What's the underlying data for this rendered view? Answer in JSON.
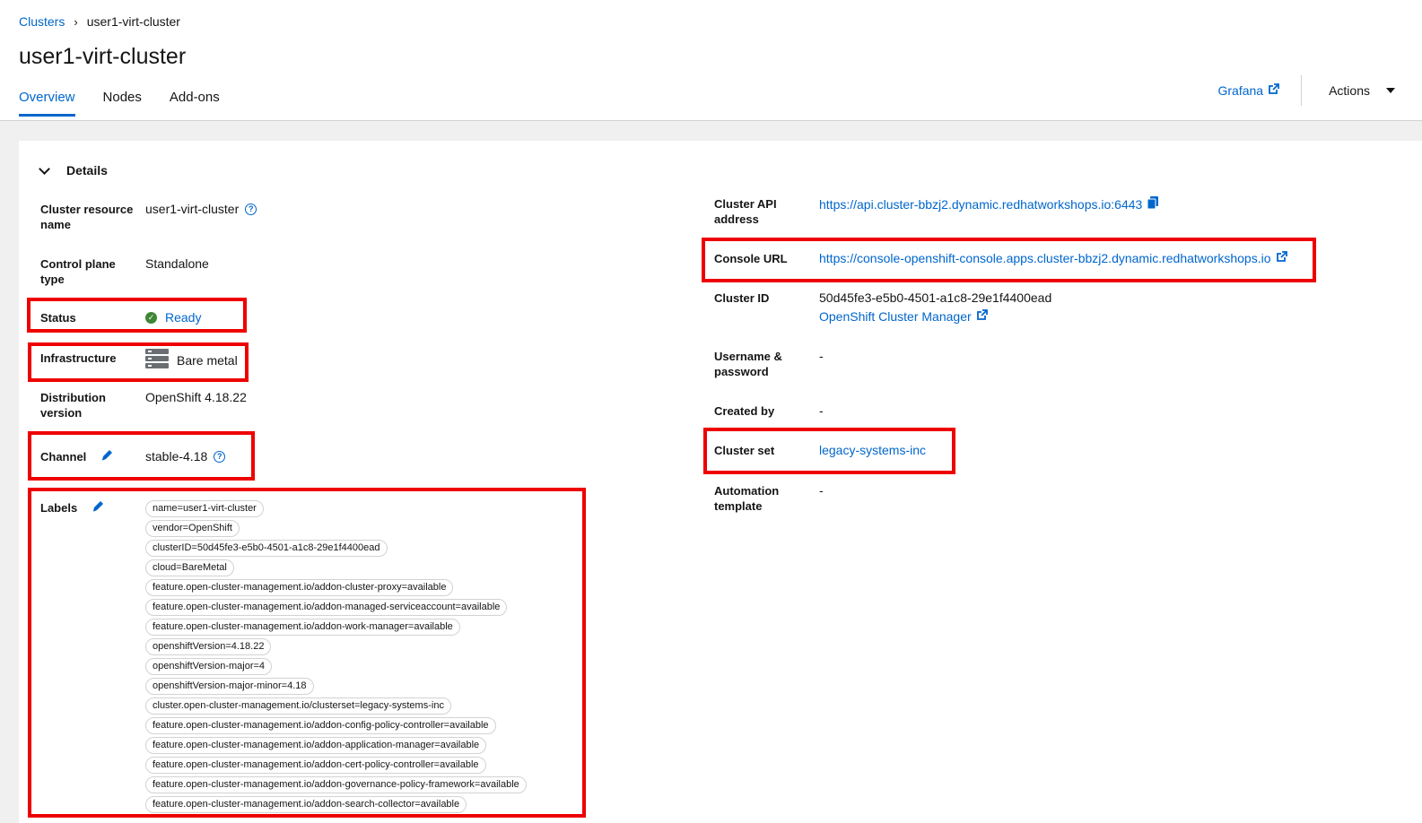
{
  "breadcrumb": {
    "root": "Clusters",
    "current": "user1-virt-cluster"
  },
  "page_title": "user1-virt-cluster",
  "tabs": [
    {
      "label": "Overview",
      "active": true
    },
    {
      "label": "Nodes",
      "active": false
    },
    {
      "label": "Add-ons",
      "active": false
    }
  ],
  "header_actions": {
    "grafana": "Grafana",
    "actions": "Actions"
  },
  "details": {
    "section_title": "Details",
    "left": {
      "resource_name_label": "Cluster resource name",
      "resource_name_value": "user1-virt-cluster",
      "control_plane_label": "Control plane type",
      "control_plane_value": "Standalone",
      "status_label": "Status",
      "status_value": "Ready",
      "infrastructure_label": "Infrastructure",
      "infrastructure_value": "Bare metal",
      "distribution_label": "Distribution version",
      "distribution_value": "OpenShift 4.18.22",
      "channel_label": "Channel",
      "channel_value": "stable-4.18",
      "labels_label": "Labels"
    },
    "labels": [
      "name=user1-virt-cluster",
      "vendor=OpenShift",
      "clusterID=50d45fe3-e5b0-4501-a1c8-29e1f4400ead",
      "cloud=BareMetal",
      "feature.open-cluster-management.io/addon-cluster-proxy=available",
      "feature.open-cluster-management.io/addon-managed-serviceaccount=available",
      "feature.open-cluster-management.io/addon-work-manager=available",
      "openshiftVersion=4.18.22",
      "openshiftVersion-major=4",
      "openshiftVersion-major-minor=4.18",
      "cluster.open-cluster-management.io/clusterset=legacy-systems-inc",
      "feature.open-cluster-management.io/addon-config-policy-controller=available",
      "feature.open-cluster-management.io/addon-application-manager=available",
      "feature.open-cluster-management.io/addon-cert-policy-controller=available",
      "feature.open-cluster-management.io/addon-governance-policy-framework=available",
      "feature.open-cluster-management.io/addon-search-collector=available"
    ],
    "right": {
      "api_label": "Cluster API address",
      "api_value": "https://api.cluster-bbzj2.dynamic.redhatworkshops.io:6443",
      "console_label": "Console URL",
      "console_value": "https://console-openshift-console.apps.cluster-bbzj2.dynamic.redhatworkshops.io",
      "cluster_id_label": "Cluster ID",
      "cluster_id_value": "50d45fe3-e5b0-4501-a1c8-29e1f4400ead",
      "ocm_link": "OpenShift Cluster Manager",
      "username_label": "Username & password",
      "username_value": "-",
      "created_by_label": "Created by",
      "created_by_value": "-",
      "cluster_set_label": "Cluster set",
      "cluster_set_value": "legacy-systems-inc",
      "automation_label": "Automation template",
      "automation_value": "-"
    }
  },
  "colors": {
    "link": "#0066cc",
    "highlight": "#ee0000",
    "success": "#3e8635"
  }
}
